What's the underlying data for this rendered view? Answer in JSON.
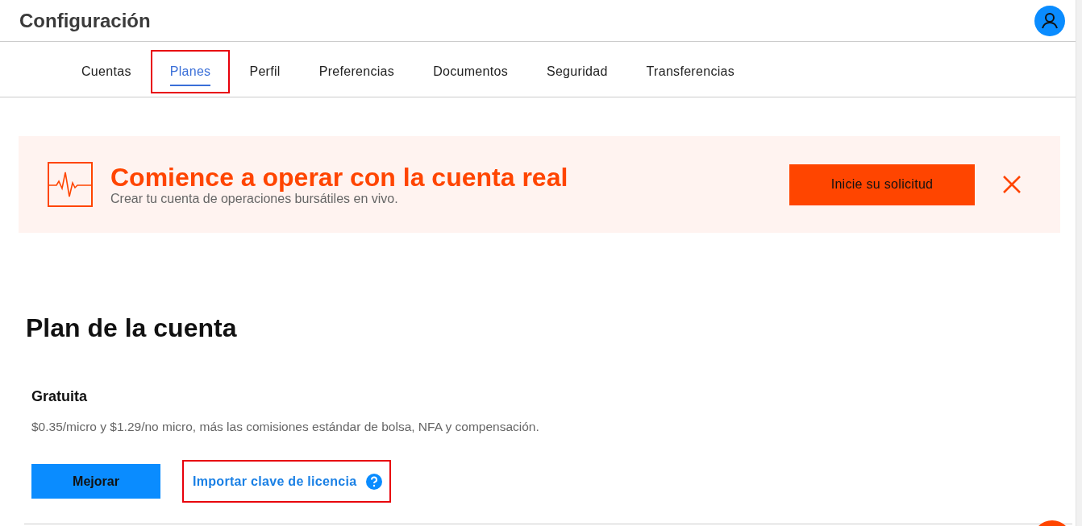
{
  "header": {
    "title": "Configuración"
  },
  "tabs": [
    {
      "label": "Cuentas",
      "selected": false,
      "highlighted": false
    },
    {
      "label": "Planes",
      "selected": true,
      "highlighted": true
    },
    {
      "label": "Perfil",
      "selected": false,
      "highlighted": false
    },
    {
      "label": "Preferencias",
      "selected": false,
      "highlighted": false
    },
    {
      "label": "Documentos",
      "selected": false,
      "highlighted": false
    },
    {
      "label": "Seguridad",
      "selected": false,
      "highlighted": false
    },
    {
      "label": "Transferencias",
      "selected": false,
      "highlighted": false
    }
  ],
  "banner": {
    "title": "Comience a operar con la cuenta real",
    "subtitle": "Crear tu cuenta de operaciones bursátiles en vivo.",
    "button": "Inicie su solicitud"
  },
  "plan": {
    "heading": "Plan de la cuenta",
    "name": "Gratuita",
    "description": "$0.35/micro y $1.29/no micro, más las comisiones estándar de bolsa, NFA y compensación.",
    "upgrade_button": "Mejorar",
    "license_link": {
      "label": "Importar clave de licencia",
      "highlighted": true
    }
  }
}
